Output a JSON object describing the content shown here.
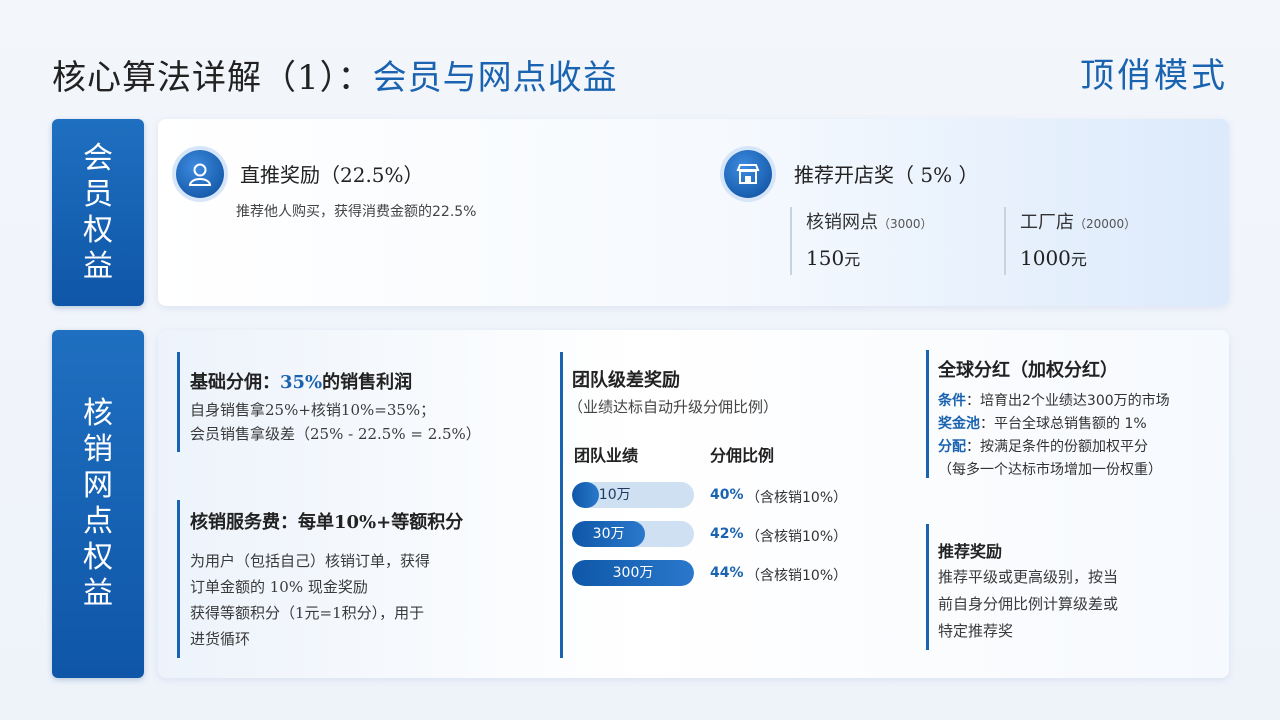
{
  "header": {
    "title_prefix": "核心算法详解（1）：",
    "title_accent": "会员与网点收益",
    "brand": "顶俏模式"
  },
  "member": {
    "tab_label": "会员权益",
    "direct": {
      "title": "直推奖励（22.5%）",
      "desc": "推荐他人购买，获得消费金额的22.5%",
      "icon": "user-icon"
    },
    "store": {
      "title": "推荐开店奖（ 5% ）",
      "icon": "store-icon",
      "items": [
        {
          "label": "核销网点",
          "note": "（3000）",
          "value": "150",
          "unit": "元"
        },
        {
          "label": "工厂店",
          "note": "（20000）",
          "value": "1000",
          "unit": "元"
        }
      ]
    }
  },
  "outlet": {
    "tab_label": "核销网点权益",
    "base": {
      "title_prefix": "基础分佣：",
      "title_highlight": "35%",
      "title_suffix": "的销售利润",
      "lines": [
        "自身销售拿25%+核销10%=35%；",
        "会员销售拿级差（25% - 22.5% = 2.5%）"
      ]
    },
    "service": {
      "title": "核销服务费：每单10%+等额积分",
      "lines": [
        "为用户（包括自己）核销订单，获得",
        "订单金额的 10% 现金奖励",
        "获得等额积分（1元=1积分），用于",
        "进货循环"
      ]
    },
    "team": {
      "title": "团队级差奖励",
      "subtitle": "（业绩达标自动升级分佣比例）",
      "col_performance": "团队业绩",
      "col_ratio": "分佣比例",
      "rows": [
        {
          "label": "10万",
          "fill": 0.22,
          "pct": "40%",
          "note": "（含核销10%）"
        },
        {
          "label": "30万",
          "fill": 0.6,
          "pct": "42%",
          "note": "（含核销10%）"
        },
        {
          "label": "300万",
          "fill": 1.0,
          "pct": "44%",
          "note": "（含核销10%）"
        }
      ]
    },
    "global": {
      "title": "全球分红（加权分红）",
      "rows": [
        {
          "key": "条件",
          "text": "：培育出2个业绩达300万的市场"
        },
        {
          "key": "奖金池",
          "text": "：平台全球总销售额的 1%"
        },
        {
          "key": "分配",
          "text": "：按满足条件的份额加权平分"
        }
      ],
      "extra": "（每多一个达标市场增加一份权重）"
    },
    "referral": {
      "title": "推荐奖励",
      "lines": [
        "推荐平级或更高级别，按当",
        "前自身分佣比例计算级差或",
        "特定推荐奖"
      ]
    }
  },
  "colors": {
    "accent": "#1a63b0",
    "tab_bg": "#1565b8"
  }
}
